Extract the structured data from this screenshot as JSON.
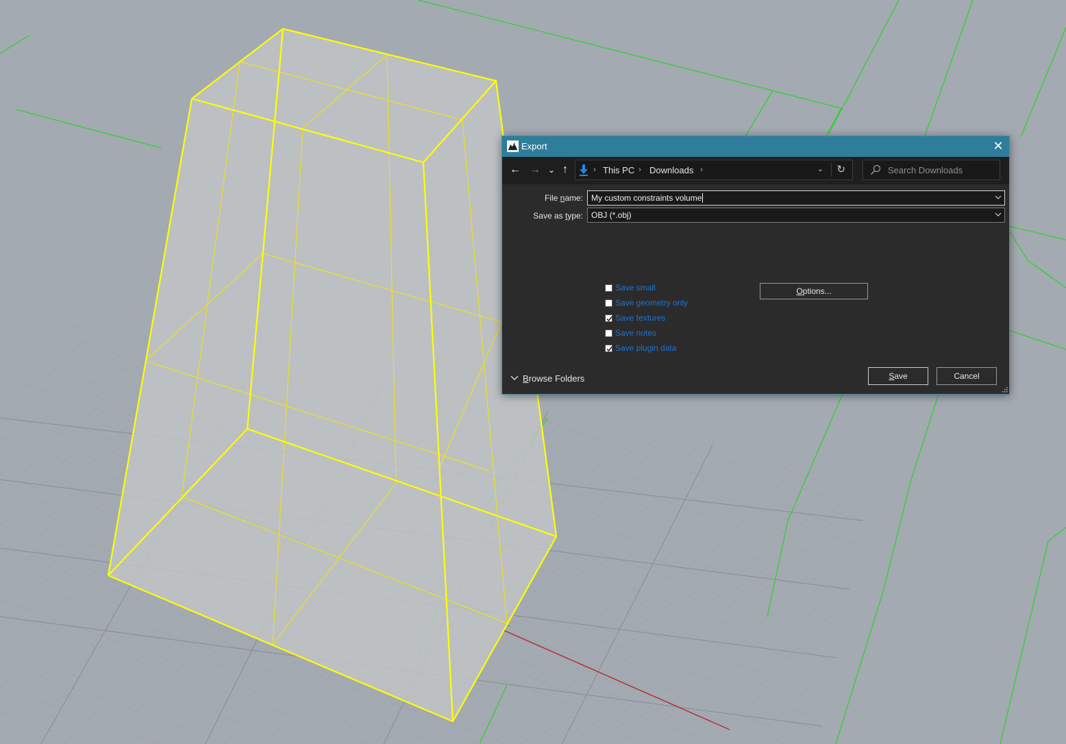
{
  "dialog": {
    "title": "Export",
    "close_glyph": "✕",
    "nav": {
      "back_glyph": "←",
      "forward_glyph": "→",
      "recent_glyph": "⌄",
      "up_glyph": "↑"
    },
    "address": {
      "icon": "downloads-arrow-icon",
      "breadcrumbs": [
        "This PC",
        "Downloads"
      ],
      "separator": "›",
      "dropdown_glyph": "⌄",
      "refresh_glyph": "↻"
    },
    "search": {
      "placeholder": "Search Downloads"
    },
    "file_name": {
      "label_prefix": "File ",
      "label_underlined": "n",
      "label_suffix": "ame:",
      "value": "My custom constraints volume"
    },
    "save_as_type": {
      "label_prefix": "Save as ",
      "label_underlined": "t",
      "label_suffix": "ype:",
      "value": "OBJ (*.obj)"
    },
    "options": [
      {
        "label": "Save small",
        "checked": false
      },
      {
        "label": "Save geometry only",
        "checked": false
      },
      {
        "label": "Save textures",
        "checked": true
      },
      {
        "label": "Save notes",
        "checked": false
      },
      {
        "label": "Save plugin data",
        "checked": true
      }
    ],
    "options_button": {
      "label_underlined": "O",
      "label_rest": "ptions..."
    },
    "browse_folders": {
      "label_underlined": "B",
      "label_rest": "rowse Folders"
    },
    "save_button": {
      "label_underlined": "S",
      "label_rest": "ave"
    },
    "cancel_button": {
      "label": "Cancel"
    },
    "accent_color": "#2e7d9a",
    "link_color": "#1d74d6"
  },
  "viewport": {
    "background_color": "#a4aab2",
    "selection_color": "#ffff00",
    "grid_color": "#8f959c",
    "green_curve_color": "#2fd12f",
    "x_axis_color": "#b03030"
  }
}
